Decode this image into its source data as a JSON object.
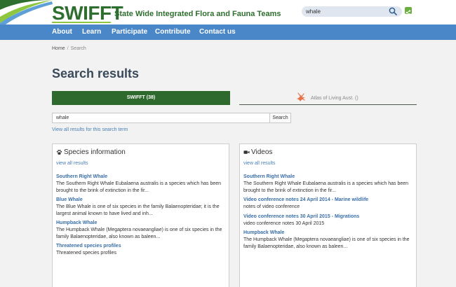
{
  "brand": {
    "logo": "SWIFFT",
    "tagline": "State Wide Integrated Flora and Fauna Teams"
  },
  "header_search": {
    "value": "whale"
  },
  "nav": [
    {
      "label": "About"
    },
    {
      "label": "Learn"
    },
    {
      "label": "Participate"
    },
    {
      "label": "Contribute"
    },
    {
      "label": "Contact us"
    }
  ],
  "breadcrumb": {
    "home": "Home",
    "separator": "/",
    "current": "Search"
  },
  "page_title": "Search results",
  "tabs": {
    "swifft": "SWIFFT (38)",
    "ala": "Atlas of Living Aust. ()"
  },
  "search": {
    "value": "whale",
    "button": "Search",
    "view_all": "View all results for this search term"
  },
  "species_panel": {
    "title": "Species information",
    "view_all": "view all results",
    "results": [
      {
        "title": "Southern Right Whale",
        "desc": [
          "The Southern Right Whale  Eubalaena australis is a species which has been",
          "brought to the brink of extinction in the fir..."
        ]
      },
      {
        "title": "Blue Whale",
        "desc": [
          "The Blue Whale is one of six species in the family Balaenopteridae; it is the",
          "largest animal known to have lived and inh..."
        ]
      },
      {
        "title": "Humpback Whale",
        "desc": [
          "The Humpback Whale (Megaptera novaeangliae) is one of six species in the",
          "family Balaenopteridae, also known as baleen..."
        ]
      },
      {
        "title": "Threatened species profiles",
        "desc": [
          "Threatened species profiles"
        ]
      }
    ]
  },
  "videos_panel": {
    "title": "Videos",
    "view_all": "view all results",
    "results": [
      {
        "title": "Southern Right Whale",
        "desc": [
          "The Southern Right Whale  Eubalaena australis is a species which has been",
          "brought to the brink of extinction in the fir..."
        ]
      },
      {
        "title": "Video conference notes 24 April 2014 - Marine wildlife",
        "desc": [
          "notes of video conference"
        ]
      },
      {
        "title": "Video conference notes 30 April 2015 - Migrations",
        "desc": [
          "video conference notes 30 April 2015"
        ]
      },
      {
        "title": "Humpback Whale",
        "desc": [
          "The Humpback Whale (Megaptera novaeangliae) is one of six species in the",
          "family Balaenopteridae, also known as baleen..."
        ]
      }
    ]
  },
  "colors": {
    "brand_green": "#2e6e2e",
    "nav_blue": "#4a87c8",
    "link_blue": "#3a6fa8",
    "accent_lime": "#8dc63f"
  },
  "icons": {
    "header_search": "search-icon",
    "share": "share-icon",
    "ala_tab": "bird-icon",
    "species_panel": "paw-icon",
    "videos_panel": "video-camera-icon"
  }
}
